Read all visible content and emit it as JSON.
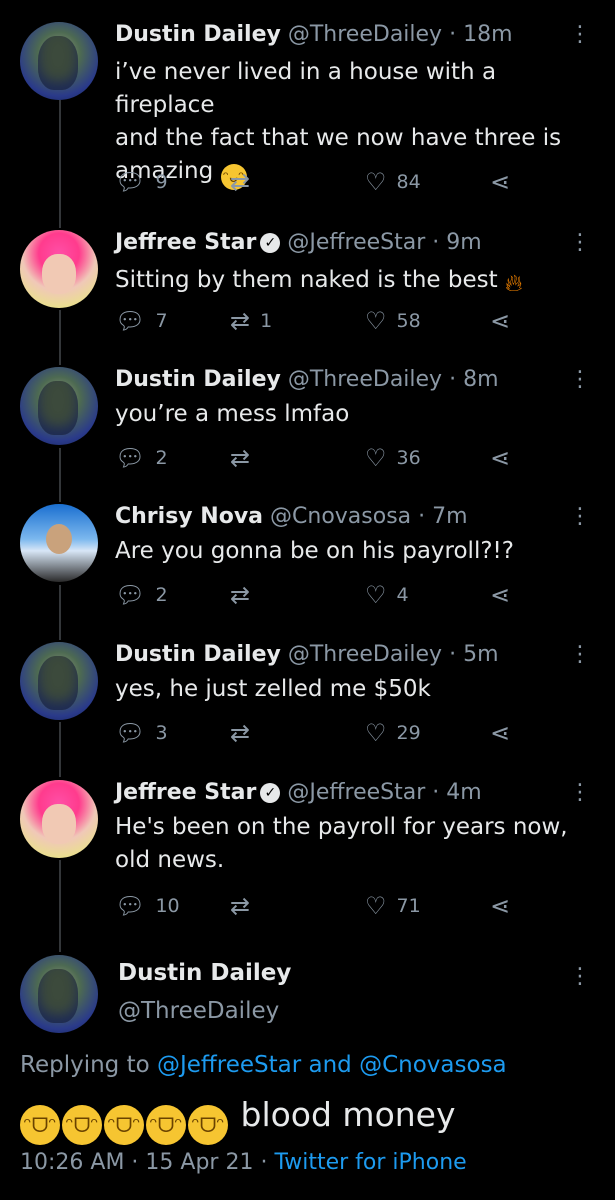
{
  "replies": [
    {
      "name": "Dustin Dailey",
      "handle": "@ThreeDailey",
      "time": "18m",
      "verified": false,
      "text_lines": [
        "i’ve never lived in a house with a fireplace",
        "and the fact that we now have three is",
        "amazing"
      ],
      "emoji": "grinning-face",
      "replies": "9",
      "retweets": "",
      "likes": "84"
    },
    {
      "name": "Jeffree Star",
      "handle": "@JeffreeStar",
      "time": "9m",
      "verified": true,
      "text_lines": [
        "Sitting by them naked is the best"
      ],
      "emoji": "fire",
      "replies": "7",
      "retweets": "1",
      "likes": "58"
    },
    {
      "name": "Dustin Dailey",
      "handle": "@ThreeDailey",
      "time": "8m",
      "verified": false,
      "text_lines": [
        "you’re a mess lmfao"
      ],
      "replies": "2",
      "retweets": "",
      "likes": "36"
    },
    {
      "name": "Chrisy Nova",
      "handle": "@Cnovasosa",
      "time": "7m",
      "verified": false,
      "text_lines": [
        "Are you gonna be on his payroll?!?"
      ],
      "replies": "2",
      "retweets": "",
      "likes": "4"
    },
    {
      "name": "Dustin Dailey",
      "handle": "@ThreeDailey",
      "time": "5m",
      "verified": false,
      "text_lines": [
        "yes, he just zelled me $50k"
      ],
      "replies": "3",
      "retweets": "",
      "likes": "29"
    },
    {
      "name": "Jeffree Star",
      "handle": "@JeffreeStar",
      "time": "4m",
      "verified": true,
      "text_lines": [
        "He's been on the payroll for years now,",
        "old news."
      ],
      "replies": "10",
      "retweets": "",
      "likes": "71"
    }
  ],
  "main_tweet": {
    "name": "Dustin Dailey",
    "handle": "@ThreeDailey",
    "replying_prefix": "Replying to",
    "reply_to_1": "@JeffreeStar",
    "reply_and": "and",
    "reply_to_2": "@Cnovasosa",
    "text": "blood money",
    "emoji_count": "5",
    "emoji": "rolling-on-floor-laughing",
    "time": "10:26 AM",
    "date": "15 Apr 21",
    "source": "Twitter for iPhone"
  },
  "colors": {
    "background": "#000000",
    "link": "#1d9bf0",
    "secondary": "#8b98a5"
  }
}
